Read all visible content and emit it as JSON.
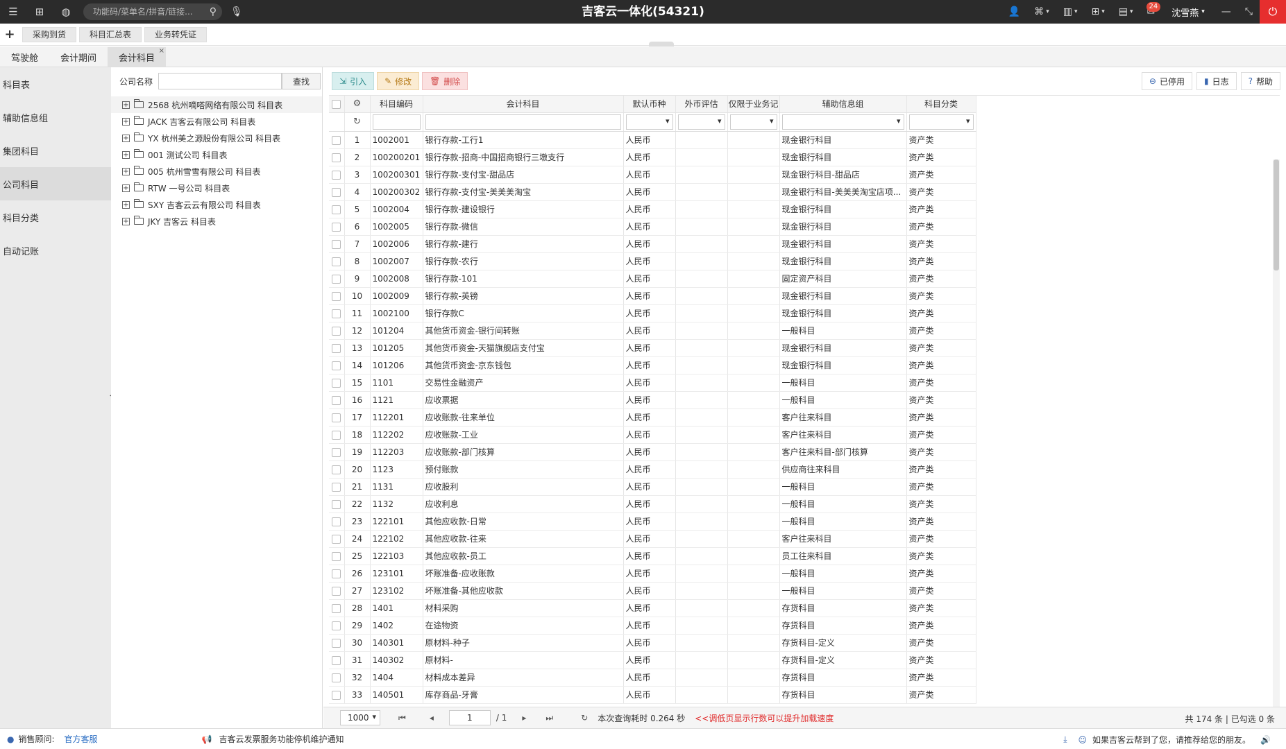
{
  "topbar": {
    "search_placeholder": "功能码/菜单名/拼音/链接...",
    "title": "吉客云一体化(54321)",
    "mail_badge": "24",
    "username": "沈雪燕"
  },
  "quickbar": {
    "buttons": [
      "采购到货",
      "科目汇总表",
      "业务转凭证"
    ]
  },
  "module_tabs": [
    "驾驶舱",
    "会计期间",
    "会计科目"
  ],
  "left_nav": [
    "科目表",
    "辅助信息组",
    "集团科目",
    "公司科目",
    "科目分类",
    "自动记账"
  ],
  "tree": {
    "label": "公司名称",
    "search_button": "查找",
    "nodes": [
      "2568 杭州嘀嗒网络有限公司 科目表",
      "JACK 吉客云有限公司 科目表",
      "YX 杭州美之源股份有限公司 科目表",
      "001 测试公司 科目表",
      "005 杭州雪雪有限公司 科目表",
      "RTW 一号公司 科目表",
      "SXY 吉客云云有限公司 科目表",
      "JKY 吉客云 科目表"
    ]
  },
  "toolbar": {
    "import": "引入",
    "edit": "修改",
    "delete": "删除",
    "disabled": "已停用",
    "log": "日志",
    "help": "帮助"
  },
  "grid": {
    "headers": [
      "科目编码",
      "会计科目",
      "默认币种",
      "外币评估",
      "仅限于业务记",
      "辅助信息组",
      "科目分类"
    ],
    "rows": [
      [
        "1",
        "1002001",
        "银行存款-工行1",
        "人民币",
        "",
        "",
        "现金银行科目",
        "资产类"
      ],
      [
        "2",
        "100200201",
        "银行存款-招商-中国招商银行三墩支行",
        "人民币",
        "",
        "",
        "现金银行科目",
        "资产类"
      ],
      [
        "3",
        "100200301",
        "银行存款-支付宝-甜品店",
        "人民币",
        "",
        "",
        "现金银行科目-甜品店",
        "资产类"
      ],
      [
        "4",
        "100200302",
        "银行存款-支付宝-美美美淘宝",
        "人民币",
        "",
        "",
        "现金银行科目-美美美淘宝店项...",
        "资产类"
      ],
      [
        "5",
        "1002004",
        "银行存款-建设银行",
        "人民币",
        "",
        "",
        "现金银行科目",
        "资产类"
      ],
      [
        "6",
        "1002005",
        "银行存款-微信",
        "人民币",
        "",
        "",
        "现金银行科目",
        "资产类"
      ],
      [
        "7",
        "1002006",
        "银行存款-建行",
        "人民币",
        "",
        "",
        "现金银行科目",
        "资产类"
      ],
      [
        "8",
        "1002007",
        "银行存款-农行",
        "人民币",
        "",
        "",
        "现金银行科目",
        "资产类"
      ],
      [
        "9",
        "1002008",
        "银行存款-101",
        "人民币",
        "",
        "",
        "固定资产科目",
        "资产类"
      ],
      [
        "10",
        "1002009",
        "银行存款-英镑",
        "人民币",
        "",
        "",
        "现金银行科目",
        "资产类"
      ],
      [
        "11",
        "1002100",
        "银行存款C",
        "人民币",
        "",
        "",
        "现金银行科目",
        "资产类"
      ],
      [
        "12",
        "101204",
        "其他货币资金-银行间转账",
        "人民币",
        "",
        "",
        "一般科目",
        "资产类"
      ],
      [
        "13",
        "101205",
        "其他货币资金-天猫旗舰店支付宝",
        "人民币",
        "",
        "",
        "现金银行科目",
        "资产类"
      ],
      [
        "14",
        "101206",
        "其他货币资金-京东钱包",
        "人民币",
        "",
        "",
        "现金银行科目",
        "资产类"
      ],
      [
        "15",
        "1101",
        "交易性金融资产",
        "人民币",
        "",
        "",
        "一般科目",
        "资产类"
      ],
      [
        "16",
        "1121",
        "应收票据",
        "人民币",
        "",
        "",
        "一般科目",
        "资产类"
      ],
      [
        "17",
        "112201",
        "应收账款-往来单位",
        "人民币",
        "",
        "",
        "客户往来科目",
        "资产类"
      ],
      [
        "18",
        "112202",
        "应收账款-工业",
        "人民币",
        "",
        "",
        "客户往来科目",
        "资产类"
      ],
      [
        "19",
        "112203",
        "应收账款-部门核算",
        "人民币",
        "",
        "",
        "客户往来科目-部门核算",
        "资产类"
      ],
      [
        "20",
        "1123",
        "预付账款",
        "人民币",
        "",
        "",
        "供应商往来科目",
        "资产类"
      ],
      [
        "21",
        "1131",
        "应收股利",
        "人民币",
        "",
        "",
        "一般科目",
        "资产类"
      ],
      [
        "22",
        "1132",
        "应收利息",
        "人民币",
        "",
        "",
        "一般科目",
        "资产类"
      ],
      [
        "23",
        "122101",
        "其他应收款-日常",
        "人民币",
        "",
        "",
        "一般科目",
        "资产类"
      ],
      [
        "24",
        "122102",
        "其他应收款-往来",
        "人民币",
        "",
        "",
        "客户往来科目",
        "资产类"
      ],
      [
        "25",
        "122103",
        "其他应收款-员工",
        "人民币",
        "",
        "",
        "员工往来科目",
        "资产类"
      ],
      [
        "26",
        "123101",
        "坏账准备-应收账款",
        "人民币",
        "",
        "",
        "一般科目",
        "资产类"
      ],
      [
        "27",
        "123102",
        "坏账准备-其他应收款",
        "人民币",
        "",
        "",
        "一般科目",
        "资产类"
      ],
      [
        "28",
        "1401",
        "材料采购",
        "人民币",
        "",
        "",
        "存货科目",
        "资产类"
      ],
      [
        "29",
        "1402",
        "在途物资",
        "人民币",
        "",
        "",
        "存货科目",
        "资产类"
      ],
      [
        "30",
        "140301",
        "原材料-种子",
        "人民币",
        "",
        "",
        "存货科目-定义",
        "资产类"
      ],
      [
        "31",
        "140302",
        "原材料-",
        "人民币",
        "",
        "",
        "存货科目-定义",
        "资产类"
      ],
      [
        "32",
        "1404",
        "材料成本差异",
        "人民币",
        "",
        "",
        "存货科目",
        "资产类"
      ],
      [
        "33",
        "140501",
        "库存商品-牙膏",
        "人民币",
        "",
        "",
        "存货科目",
        "资产类"
      ]
    ]
  },
  "pager": {
    "page_size": "1000",
    "current_page": "1",
    "total_pages": "/ 1",
    "query_time": "本次查询耗时 0.264 秒",
    "warning": "<<调低页显示行数可以提升加载速度",
    "summary": "共 174 条 | 已勾选 0 条"
  },
  "statusbar": {
    "advisor_label": "销售顾问:",
    "advisor_link": "官方客服",
    "notice": "吉客云发票服务功能停机维护通知",
    "recommend": "如果吉客云帮到了您，请推荐给您的朋友。"
  }
}
